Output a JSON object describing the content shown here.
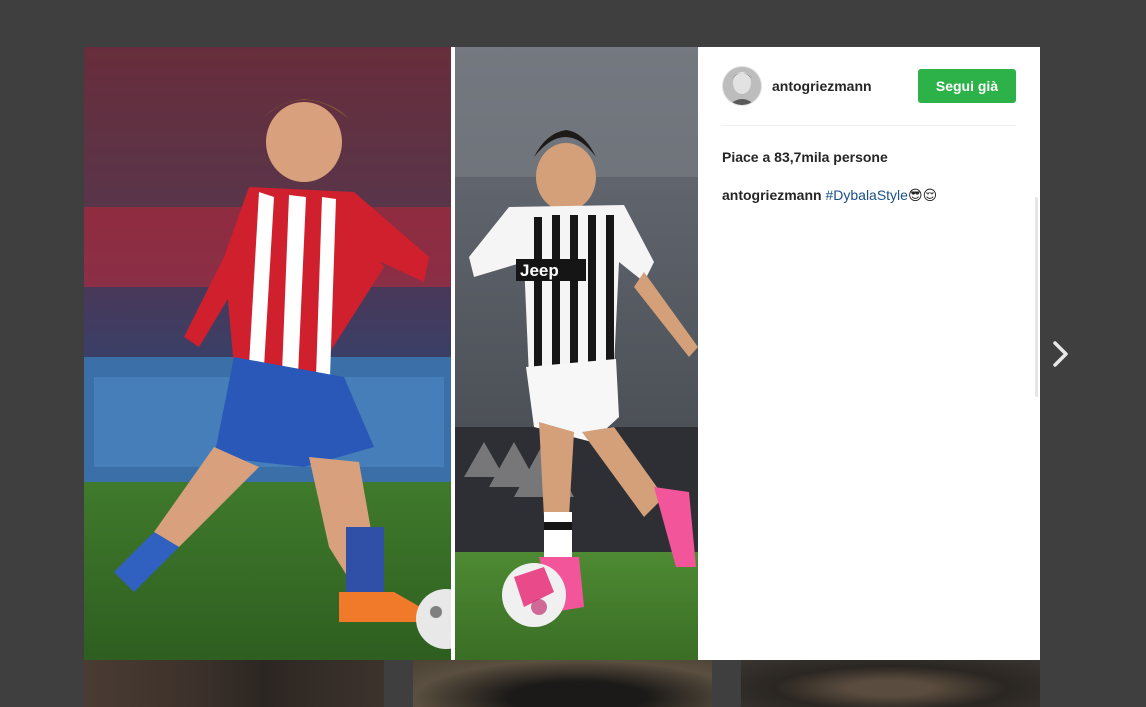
{
  "post": {
    "username": "antogriezmann",
    "follow_label": "Segui già",
    "likes_text": "Piace a 83,7mila persone",
    "caption_user": "antogriezmann",
    "caption_hashtag": "#DybalaStyle",
    "caption_emojis": "😎😌"
  },
  "colors": {
    "follow_button": "#2db24a",
    "hashtag": "#1a4e86",
    "overlay": "#3f3f3f"
  },
  "icons": {
    "next": "chevron-right-icon"
  }
}
